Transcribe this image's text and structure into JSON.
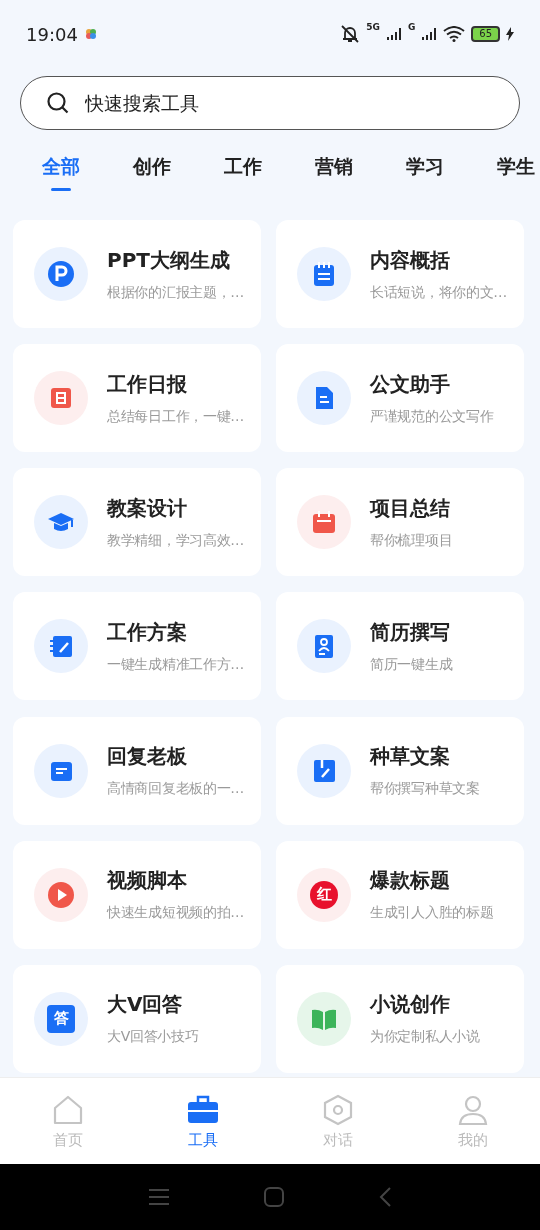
{
  "status_bar": {
    "time": "19:04",
    "network_1": "5G",
    "network_2": "G",
    "battery": "65"
  },
  "search": {
    "placeholder": "快速搜索工具"
  },
  "tabs": [
    {
      "label": "全部",
      "selected": true
    },
    {
      "label": "创作",
      "selected": false
    },
    {
      "label": "工作",
      "selected": false
    },
    {
      "label": "营销",
      "selected": false
    },
    {
      "label": "学习",
      "selected": false
    },
    {
      "label": "学生",
      "selected": false
    }
  ],
  "tools": [
    {
      "title": "PPT大纲生成",
      "description": "根据你的汇报主题，…",
      "kind": "p-badge",
      "color": "#1a6ef5"
    },
    {
      "title": "内容概括",
      "description": "长话短说，将你的文…",
      "kind": "notepad",
      "color": "#1a6ef5"
    },
    {
      "title": "工作日报",
      "description": "总结每日工作，一键…",
      "kind": "daily",
      "color": "#f0574a"
    },
    {
      "title": "公文助手",
      "description": "严谨规范的公文写作",
      "kind": "document",
      "color": "#1a6ef5"
    },
    {
      "title": "教案设计",
      "description": "教学精细，学习高效…",
      "kind": "cap",
      "color": "#1a6ef5"
    },
    {
      "title": "项目总结",
      "description": "帮你梳理项目",
      "kind": "calendar",
      "color": "#f0574a"
    },
    {
      "title": "工作方案",
      "description": "一键生成精准工作方…",
      "kind": "notebook",
      "color": "#1a6ef5"
    },
    {
      "title": "简历撰写",
      "description": "简历一键生成",
      "kind": "resume",
      "color": "#1a6ef5"
    },
    {
      "title": "回复老板",
      "description": "高情商回复老板的一…",
      "kind": "chat",
      "color": "#1a6ef5"
    },
    {
      "title": "种草文案",
      "description": "帮你撰写种草文案",
      "kind": "bookmark",
      "color": "#1a6ef5"
    },
    {
      "title": "视频脚本",
      "description": "快速生成短视频的拍…",
      "kind": "play",
      "color": "#f0574a"
    },
    {
      "title": "爆款标题",
      "description": "生成引人入胜的标题",
      "kind": "letter-circle",
      "badge": "红",
      "color": "#e8112d"
    },
    {
      "title": "大V回答",
      "description": "大V回答小技巧",
      "kind": "letter-square",
      "badge": "答",
      "color": "#1a6ef5"
    },
    {
      "title": "小说创作",
      "description": "为你定制私人小说",
      "kind": "book",
      "color": "#3cb45a"
    }
  ],
  "bottom_nav": [
    {
      "label": "首页",
      "kind": "home",
      "selected": false
    },
    {
      "label": "工具",
      "kind": "toolbox",
      "selected": true
    },
    {
      "label": "对话",
      "kind": "hexagon",
      "selected": false
    },
    {
      "label": "我的",
      "kind": "person",
      "selected": false
    }
  ]
}
